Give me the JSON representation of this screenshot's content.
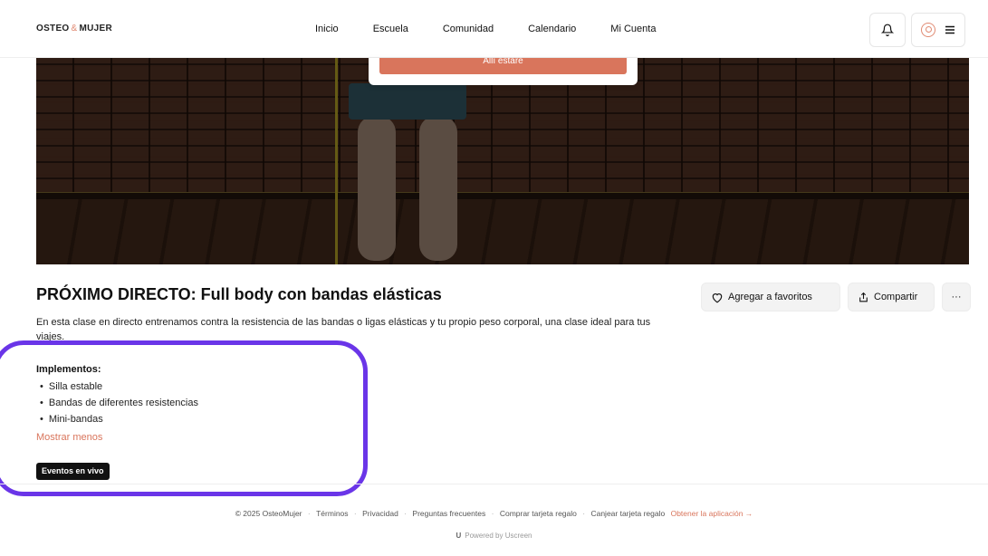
{
  "header": {
    "logo_left": "OSTEO",
    "logo_amp": "&",
    "logo_right": "MUJER",
    "nav": [
      "Inicio",
      "Escuela",
      "Comunidad",
      "Calendario",
      "Mi Cuenta"
    ]
  },
  "hero": {
    "modal_button": "Allí estaré"
  },
  "content": {
    "title": "PRÓXIMO DIRECTO: Full body con bandas elásticas",
    "description": "En esta clase en directo entrenamos contra la resistencia de las bandas o ligas elásticas y tu propio peso corporal, una clase ideal para tus viajes.",
    "implements_title": "Implementos:",
    "implements": [
      "Silla estable",
      "Bandas de diferentes resistencias",
      "Mini-bandas"
    ],
    "show_less": "Mostrar menos",
    "tag": "Eventos en vivo",
    "favorite_label": "Agregar a favoritos",
    "share_label": "Compartir",
    "more_label": "···"
  },
  "footer": {
    "links": [
      "© 2025 OsteoMujer",
      "Términos",
      "Privacidad",
      "Preguntas frecuentes",
      "Comprar tarjeta regalo",
      "Canjear tarjeta regalo"
    ],
    "app_link": "Obtener la aplicación →",
    "powered": "Powered by Uscreen"
  },
  "colors": {
    "accent": "#d9755c",
    "highlight": "#6a35e8"
  }
}
